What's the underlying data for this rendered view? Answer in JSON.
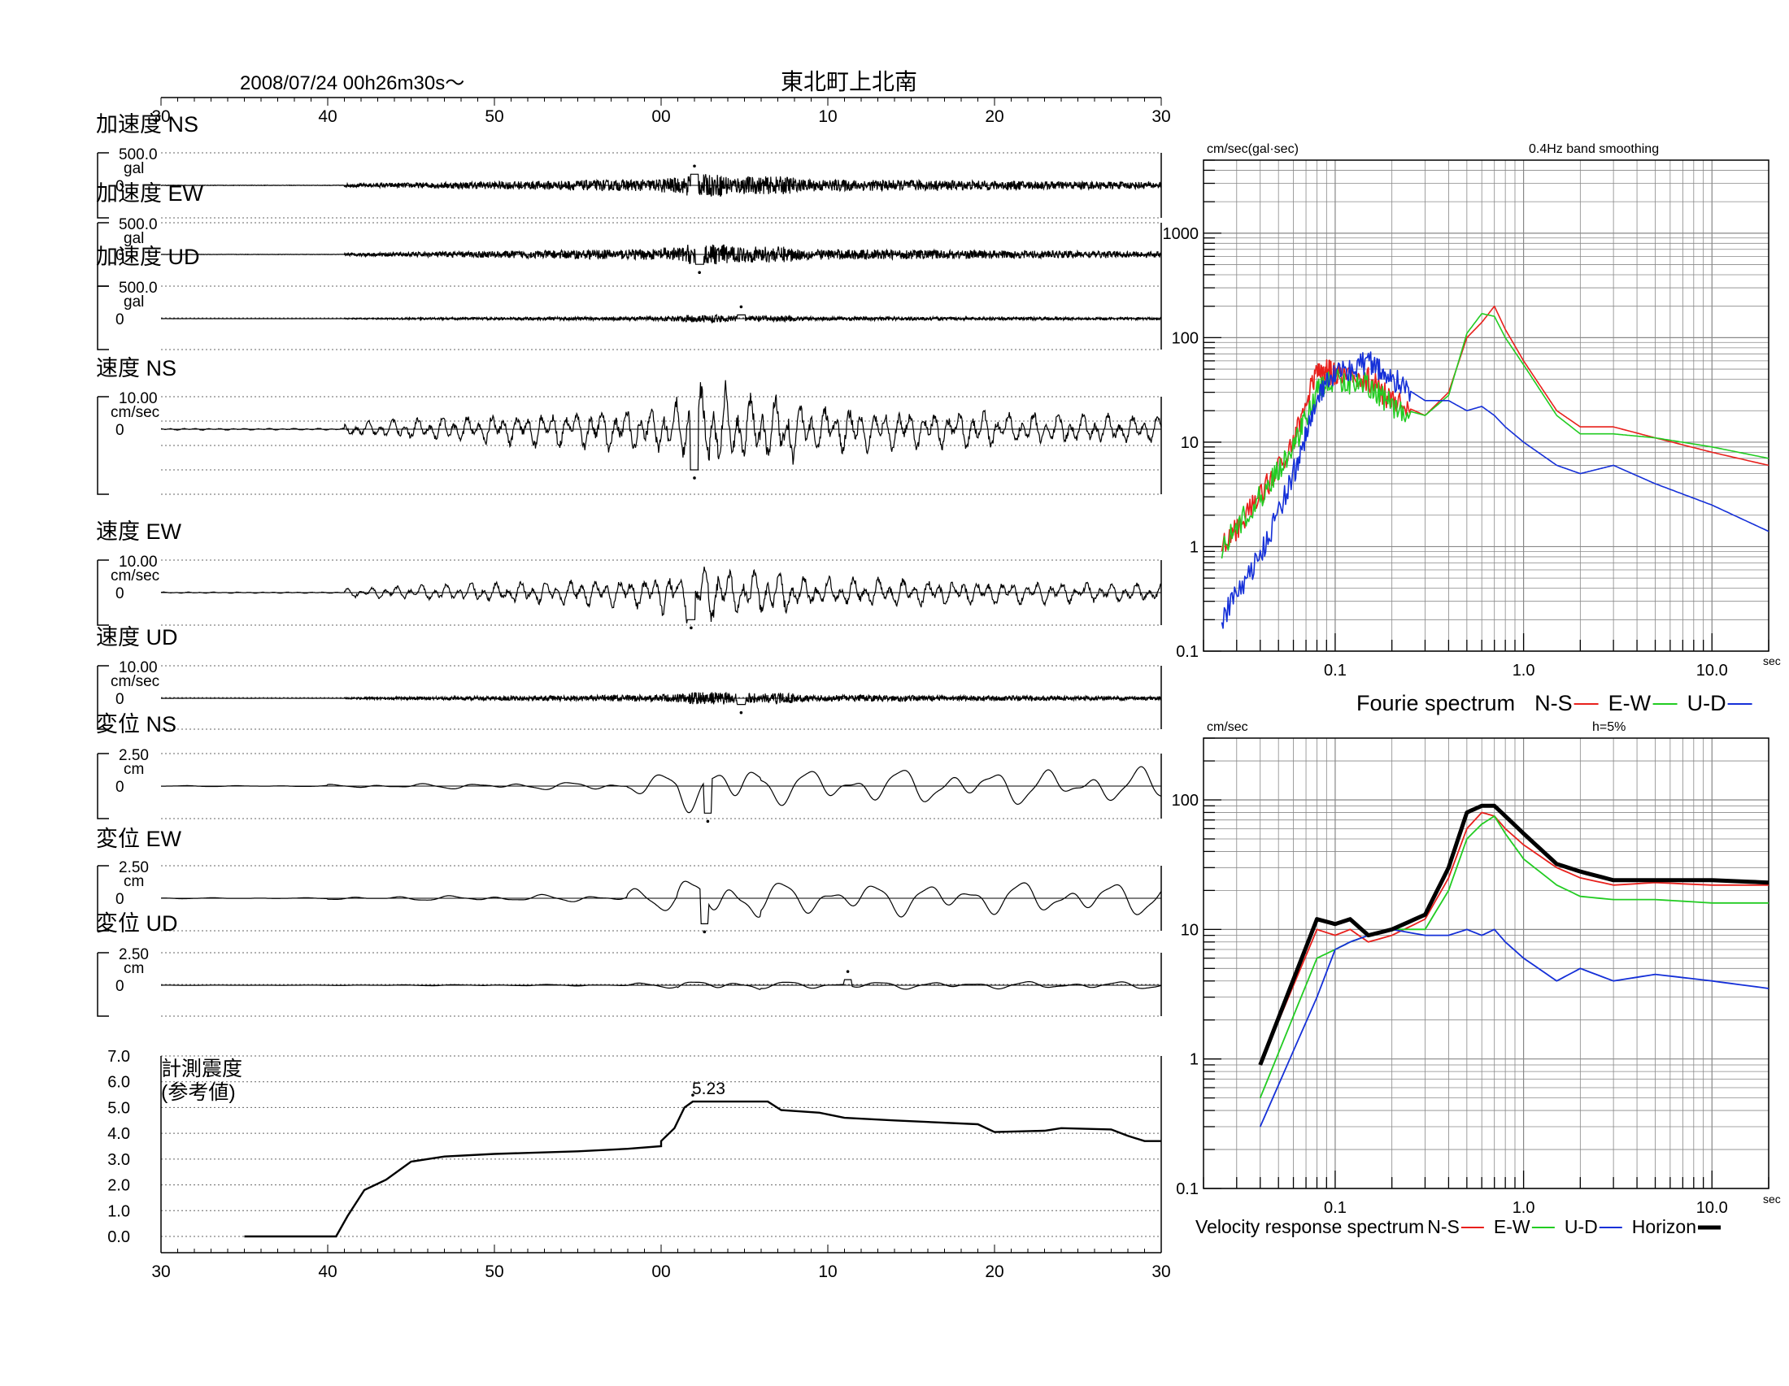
{
  "header": {
    "datetime": "2008/07/24  00h26m30s〜",
    "station": "東北町上北南"
  },
  "time_axis": {
    "ticks": [
      "30",
      "40",
      "50",
      "00",
      "10",
      "20",
      "30"
    ]
  },
  "traces": [
    {
      "id": "acc-ns",
      "label": "加速度 NS",
      "scale": "500.0",
      "unit": "gal",
      "zero": "0",
      "type": "acc",
      "amp": 0.35,
      "peak_t": 2.0,
      "peak_sign": 1
    },
    {
      "id": "acc-ew",
      "label": "加速度 EW",
      "scale": "500.0",
      "unit": "gal",
      "zero": "0",
      "type": "acc",
      "amp": 0.32,
      "peak_t": 2.3,
      "peak_sign": -1
    },
    {
      "id": "acc-ud",
      "label": "加速度 UD",
      "scale": "500.0",
      "unit": "gal",
      "zero": "0",
      "type": "acc",
      "amp": 0.12,
      "peak_t": 4.8,
      "peak_sign": 1
    },
    {
      "id": "vel-ns",
      "label": "速度 NS",
      "scale": "10.00",
      "unit": "cm/sec",
      "zero": "0",
      "type": "vel",
      "amp": 0.85,
      "peak_t": 2.0,
      "peak_sign": -1
    },
    {
      "id": "vel-ew",
      "label": "速度 EW",
      "scale": "10.00",
      "unit": "cm/sec",
      "zero": "0",
      "type": "vel",
      "amp": 0.85,
      "peak_t": 1.8,
      "peak_sign": -1
    },
    {
      "id": "vel-ud",
      "label": "速度 UD",
      "scale": "10.00",
      "unit": "cm/sec",
      "zero": "0",
      "type": "acc",
      "amp": 0.2,
      "peak_t": 4.8,
      "peak_sign": -1
    },
    {
      "id": "dis-ns",
      "label": "変位 NS",
      "scale": "2.50",
      "unit": "cm",
      "zero": "0",
      "type": "dis",
      "amp": 0.85,
      "peak_t": 2.8,
      "peak_sign": -1
    },
    {
      "id": "dis-ew",
      "label": "変位 EW",
      "scale": "2.50",
      "unit": "cm",
      "zero": "0",
      "type": "dis",
      "amp": 0.8,
      "peak_t": 2.6,
      "peak_sign": -1
    },
    {
      "id": "dis-ud",
      "label": "変位 UD",
      "scale": "2.50",
      "unit": "cm",
      "zero": "0",
      "type": "dis",
      "amp": 0.18,
      "peak_t": 11.2,
      "peak_sign": 1
    }
  ],
  "intensity": {
    "title_line1": "計測震度",
    "title_line2": "(参考値)",
    "y_ticks": [
      "7.0",
      "6.0",
      "5.0",
      "4.0",
      "3.0",
      "2.0",
      "1.0",
      "0.0"
    ],
    "max_label": "5.23",
    "series": [
      [
        -25,
        0
      ],
      [
        -19.5,
        0
      ],
      [
        -18.8,
        0.8
      ],
      [
        -17.8,
        1.8
      ],
      [
        -16.5,
        2.2
      ],
      [
        -15,
        2.9
      ],
      [
        -13,
        3.1
      ],
      [
        -10,
        3.2
      ],
      [
        -5,
        3.3
      ],
      [
        0,
        3.5
      ],
      [
        -2,
        3.4
      ],
      [
        0,
        3.7
      ],
      [
        0.8,
        4.2
      ],
      [
        1.4,
        5.0
      ],
      [
        1.9,
        5.23
      ],
      [
        6.4,
        5.23
      ],
      [
        7.2,
        4.9
      ],
      [
        9.5,
        4.8
      ],
      [
        11,
        4.6
      ],
      [
        14,
        4.5
      ],
      [
        19,
        4.35
      ],
      [
        20,
        4.05
      ],
      [
        23,
        4.1
      ],
      [
        24,
        4.2
      ],
      [
        27,
        4.15
      ],
      [
        28,
        3.9
      ],
      [
        29,
        3.7
      ],
      [
        30,
        3.7
      ]
    ]
  },
  "fourier": {
    "y_unit": "cm/sec(gal·sec)",
    "smoothing": "0.4Hz band smoothing",
    "y_ticks": [
      "1000",
      "100",
      "10",
      "1",
      "0.1"
    ],
    "x_ticks": [
      "0.1",
      "1.0",
      "10.0"
    ],
    "x_unit": "sec",
    "legend_title": "Fourie spectrum",
    "legend": [
      {
        "name": "N-S",
        "color": "#e8201c"
      },
      {
        "name": "E-W",
        "color": "#22cc22"
      },
      {
        "name": "U-D",
        "color": "#1530d8"
      }
    ]
  },
  "response": {
    "y_unit": "cm/sec",
    "damping": "h=5%",
    "y_ticks": [
      "100",
      "10",
      "1",
      "0.1"
    ],
    "x_ticks": [
      "0.1",
      "1.0",
      "10.0"
    ],
    "x_unit": "sec",
    "legend_title": "Velocity response spectrum",
    "legend": [
      {
        "name": "N-S",
        "color": "#e8201c",
        "width": 2
      },
      {
        "name": "E-W",
        "color": "#22cc22",
        "width": 2
      },
      {
        "name": "U-D",
        "color": "#1530d8",
        "width": 2
      },
      {
        "name": "Horizon",
        "color": "#000000",
        "width": 5
      }
    ]
  },
  "chart_data": [
    {
      "type": "line",
      "title": "東北町上北南",
      "subtitle": "2008/07/24  00h26m30s〜",
      "xlabel": "",
      "x_ticks": [
        "30",
        "40",
        "50",
        "00",
        "10",
        "20",
        "30"
      ],
      "series": [
        {
          "name": "加速度 NS",
          "peak": "500.0 gal scale"
        },
        {
          "name": "加速度 EW",
          "peak": "500.0 gal scale"
        },
        {
          "name": "加速度 UD",
          "peak": "500.0 gal scale"
        },
        {
          "name": "速度 NS",
          "peak": "10.00 cm/sec scale"
        },
        {
          "name": "速度 EW",
          "peak": "10.00 cm/sec scale"
        },
        {
          "name": "速度 UD",
          "peak": "10.00 cm/sec scale"
        },
        {
          "name": "変位 NS",
          "peak": "2.50 cm scale"
        },
        {
          "name": "変位 EW",
          "peak": "2.50 cm scale"
        },
        {
          "name": "変位 UD",
          "peak": "2.50 cm scale"
        }
      ]
    },
    {
      "type": "line",
      "title": "計測震度(参考値)",
      "ylim": [
        0,
        7
      ],
      "max_value": 5.23,
      "x": [
        -25,
        -19.5,
        -18.8,
        -17.8,
        -16.5,
        -15,
        -13,
        -10,
        -5,
        0,
        0.8,
        1.4,
        1.9,
        6.4,
        7.2,
        9.5,
        11,
        14,
        19,
        20,
        23,
        24,
        27,
        28,
        29,
        30
      ],
      "values": [
        0,
        0,
        0.8,
        1.8,
        2.2,
        2.9,
        3.1,
        3.2,
        3.3,
        3.5,
        4.2,
        5.0,
        5.23,
        5.23,
        4.9,
        4.8,
        4.6,
        4.5,
        4.35,
        4.05,
        4.1,
        4.2,
        4.15,
        3.9,
        3.7,
        3.7
      ]
    },
    {
      "type": "line",
      "title": "Fourie spectrum",
      "xlabel": "sec",
      "ylabel": "cm/sec(gal·sec)",
      "xscale": "log",
      "yscale": "log",
      "xlim": [
        0.02,
        20
      ],
      "ylim": [
        0.1,
        5000
      ],
      "x": [
        0.025,
        0.04,
        0.06,
        0.08,
        0.1,
        0.15,
        0.2,
        0.3,
        0.4,
        0.5,
        0.6,
        0.7,
        0.8,
        1.0,
        1.5,
        2,
        3,
        5,
        10,
        20
      ],
      "series": [
        {
          "name": "N-S",
          "values": [
            1,
            3,
            10,
            50,
            45,
            40,
            25,
            18,
            30,
            100,
            140,
            200,
            120,
            60,
            20,
            14,
            14,
            11,
            8,
            6
          ]
        },
        {
          "name": "E-W",
          "values": [
            1,
            3,
            9,
            30,
            40,
            35,
            22,
            18,
            28,
            110,
            170,
            160,
            100,
            55,
            18,
            12,
            12,
            11,
            9,
            7
          ]
        },
        {
          "name": "U-D",
          "values": [
            0.2,
            0.8,
            5,
            25,
            45,
            60,
            40,
            25,
            25,
            20,
            22,
            18,
            14,
            10,
            6,
            5,
            6,
            4,
            2.5,
            1.4
          ]
        }
      ]
    },
    {
      "type": "line",
      "title": "Velocity response spectrum",
      "xlabel": "sec",
      "ylabel": "cm/sec",
      "xscale": "log",
      "yscale": "log",
      "xlim": [
        0.02,
        20
      ],
      "ylim": [
        0.1,
        300
      ],
      "x": [
        0.04,
        0.08,
        0.1,
        0.12,
        0.15,
        0.2,
        0.3,
        0.4,
        0.5,
        0.6,
        0.7,
        0.8,
        1.0,
        1.5,
        2,
        3,
        5,
        10,
        20
      ],
      "series": [
        {
          "name": "N-S",
          "values": [
            0.9,
            10,
            9,
            10,
            8,
            9,
            12,
            25,
            60,
            80,
            75,
            60,
            45,
            30,
            25,
            22,
            23,
            22,
            22
          ]
        },
        {
          "name": "E-W",
          "values": [
            0.5,
            6,
            7,
            8,
            9,
            10,
            10,
            20,
            50,
            65,
            75,
            55,
            35,
            22,
            18,
            17,
            17,
            16,
            16
          ]
        },
        {
          "name": "U-D",
          "values": [
            0.3,
            3,
            7,
            8,
            9,
            10,
            9,
            9,
            10,
            9,
            10,
            8,
            6,
            4,
            5,
            4,
            4.5,
            4,
            3.5
          ]
        },
        {
          "name": "Horizon",
          "values": [
            0.9,
            12,
            11,
            12,
            9,
            10,
            13,
            30,
            80,
            90,
            90,
            75,
            55,
            32,
            28,
            24,
            24,
            24,
            23
          ]
        }
      ]
    }
  ]
}
